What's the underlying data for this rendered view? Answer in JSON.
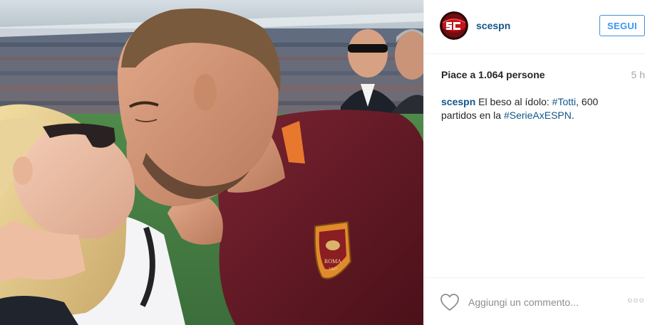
{
  "post": {
    "username": "scespn",
    "follow_label": "SEGUI",
    "likes_text": "Piace a 1.064 persone",
    "time_ago": "5 h",
    "caption": {
      "user": "scespn",
      "text_1": " El beso al ídolo: ",
      "tag_1": "#Totti",
      "text_2": ", 600 partidos en la ",
      "tag_2": "#SerieAxESPN",
      "text_3": "."
    },
    "comment_placeholder": "Aggiungi un commento...",
    "more_icon_text": "○○○"
  },
  "icons": {
    "avatar": "sportscenter-logo",
    "like": "heart-outline-icon",
    "more": "more-options-icon"
  },
  "colors": {
    "link": "#125688",
    "follow_blue": "#3897f0",
    "jersey": "#6b1f2a",
    "jersey_accent": "#e8782e"
  },
  "photo": {
    "crest_text": "ROMA",
    "crest_year": "1927"
  }
}
